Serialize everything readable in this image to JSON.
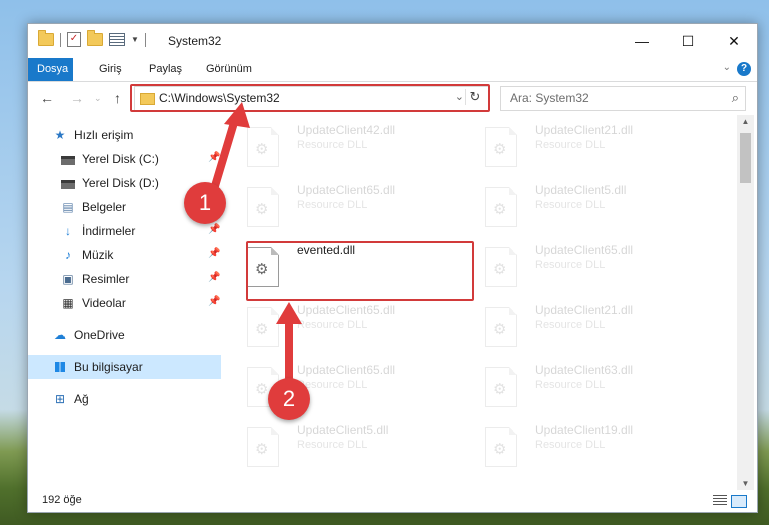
{
  "window": {
    "title": "System32",
    "controls": {
      "minimize": "—",
      "maximize": "☐",
      "close": "✕"
    }
  },
  "ribbon": {
    "tabs": [
      {
        "label": "Dosya",
        "active": true
      },
      {
        "label": "Giriş"
      },
      {
        "label": "Paylaş"
      },
      {
        "label": "Görünüm"
      }
    ],
    "help": "?"
  },
  "nav": {
    "path": "C:\\Windows\\System32",
    "search_placeholder": "Ara: System32"
  },
  "sidebar": {
    "items": [
      {
        "label": "Hızlı erişim",
        "icon": "star-icon"
      },
      {
        "label": "Yerel Disk (C:)",
        "icon": "drive-icon",
        "pinned": true
      },
      {
        "label": "Yerel Disk (D:)",
        "icon": "drive-icon"
      },
      {
        "label": "Belgeler",
        "icon": "document-icon"
      },
      {
        "label": "İndirmeler",
        "icon": "download-icon",
        "pinned": true
      },
      {
        "label": "Müzik",
        "icon": "music-icon",
        "pinned": true
      },
      {
        "label": "Resimler",
        "icon": "pictures-icon",
        "pinned": true
      },
      {
        "label": "Videolar",
        "icon": "video-icon",
        "pinned": true
      },
      {
        "label": "OneDrive",
        "icon": "cloud-icon"
      },
      {
        "label": "Bu bilgisayar",
        "icon": "computer-icon",
        "selected": true
      },
      {
        "label": "Ağ",
        "icon": "network-icon"
      }
    ]
  },
  "files": {
    "left": [
      {
        "name": "UpdateClient42.dll",
        "type": "Resource DLL"
      },
      {
        "name": "UpdateClient65.dll",
        "type": "Resource DLL"
      },
      {
        "name": "evented.dll",
        "type": ""
      },
      {
        "name": "UpdateClient65.dll",
        "type": "Resource DLL"
      },
      {
        "name": "UpdateClient65.dll",
        "type": "Resource DLL"
      },
      {
        "name": "UpdateClient5.dll",
        "type": "Resource DLL"
      }
    ],
    "right": [
      {
        "name": "UpdateClient21.dll",
        "type": "Resource DLL"
      },
      {
        "name": "UpdateClient5.dll",
        "type": "Resource DLL"
      },
      {
        "name": "UpdateClient65.dll",
        "type": "Resource DLL"
      },
      {
        "name": "UpdateClient21.dll",
        "type": "Resource DLL"
      },
      {
        "name": "UpdateClient63.dll",
        "type": "Resource DLL"
      },
      {
        "name": "UpdateClient19.dll",
        "type": "Resource DLL"
      }
    ]
  },
  "status": {
    "count": "192 öğe"
  },
  "annotations": {
    "step1": "1",
    "step2": "2",
    "color": "#e03c3c"
  }
}
